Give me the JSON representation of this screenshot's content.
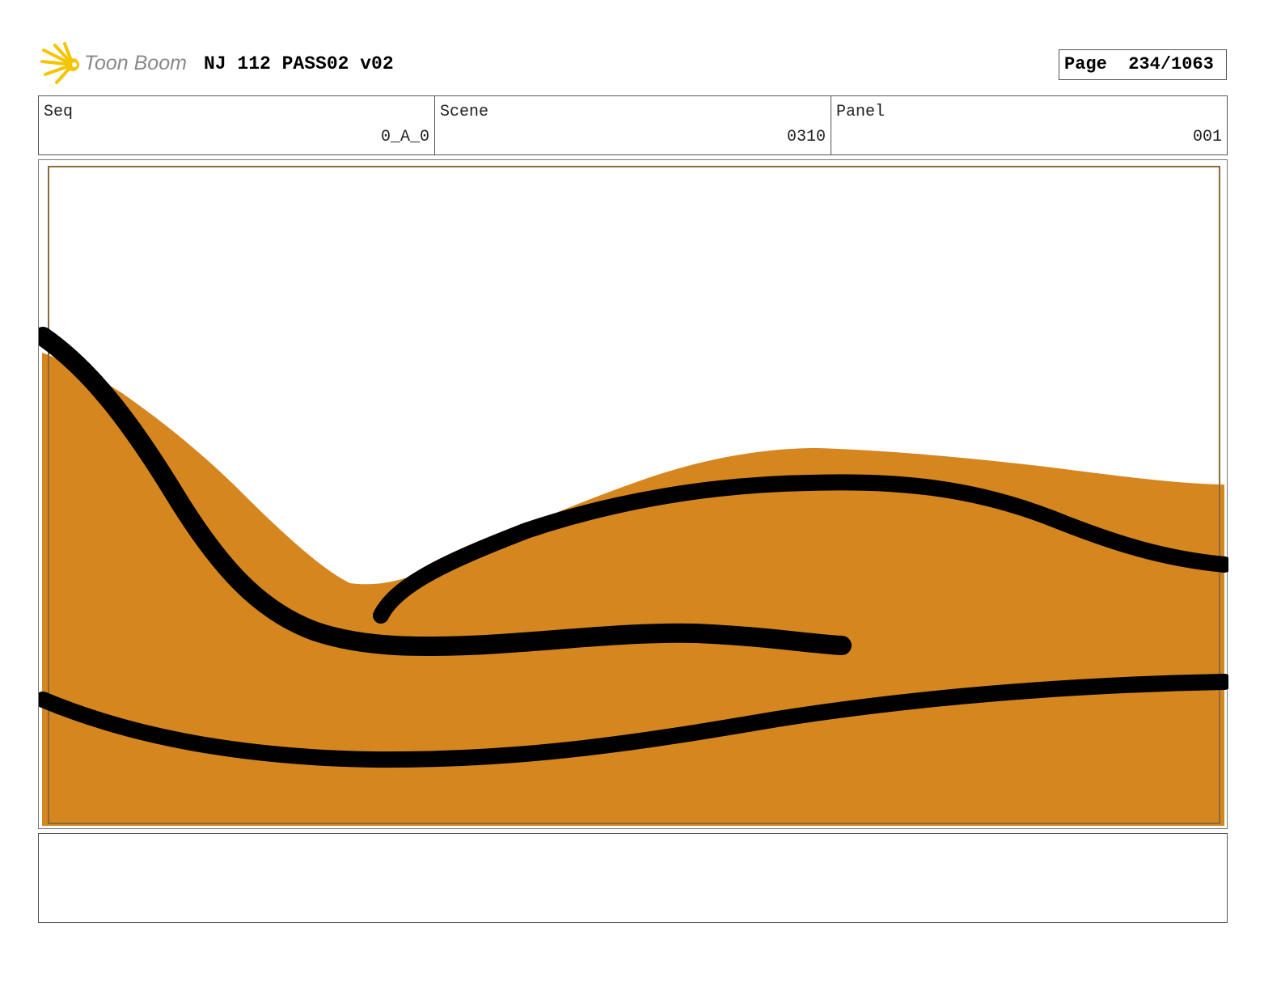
{
  "header": {
    "logo_text": "Toon Boom",
    "title": "NJ 112 PASS02 v02",
    "page_label": "Page",
    "page_value": "234/1063"
  },
  "info": {
    "seq_label": "Seq",
    "seq_value": "0_A_0",
    "scene_label": "Scene",
    "scene_value": "0310",
    "panel_label": "Panel",
    "panel_value": "001"
  },
  "colors": {
    "orange": "#d6861f",
    "ink": "#000000"
  }
}
